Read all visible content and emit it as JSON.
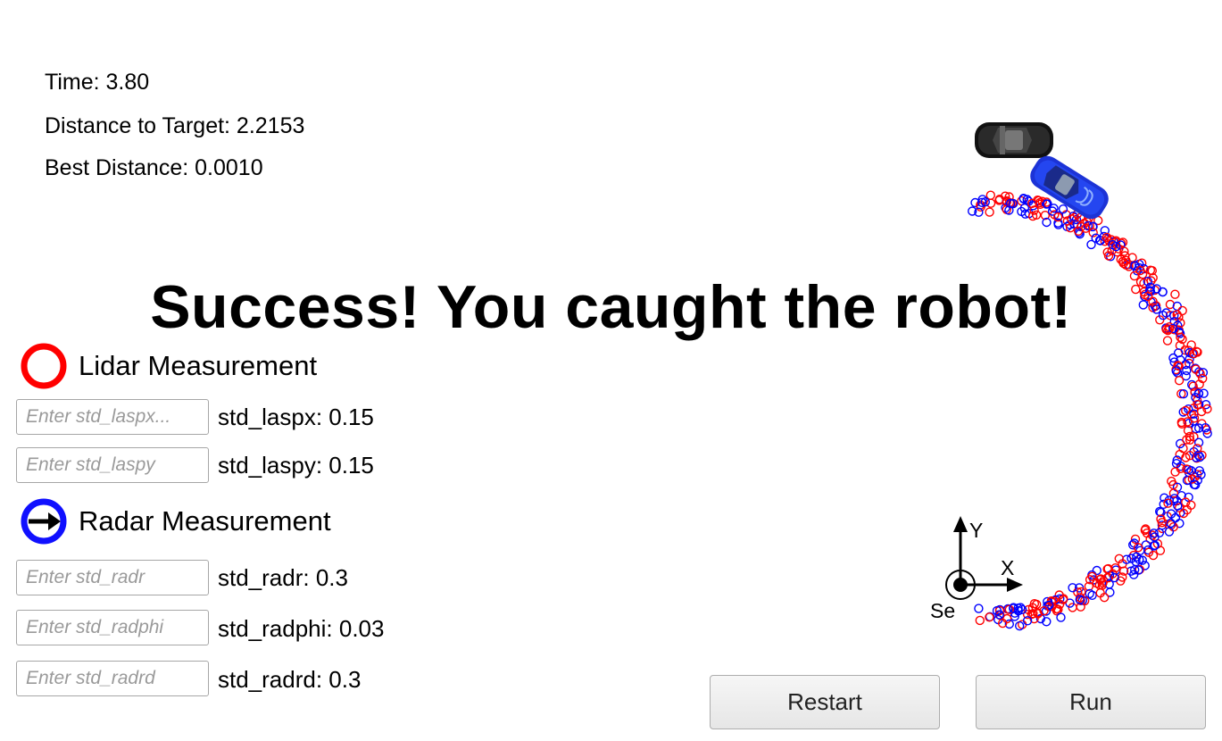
{
  "stats": {
    "time": "Time: 3.80",
    "distance_to_target": "Distance to Target: 2.2153",
    "best_distance": "Best Distance: 0.0010"
  },
  "headline": "Success! You caught the robot!",
  "lidar": {
    "legend_label": "Lidar Measurement",
    "color": "#ff0000",
    "params": [
      {
        "placeholder": "Enter std_laspx...",
        "label": "std_laspx: 0.15"
      },
      {
        "placeholder": "Enter std_laspy",
        "label": "std_laspy: 0.15"
      }
    ]
  },
  "radar": {
    "legend_label": "Radar Measurement",
    "color": "#0000ff",
    "params": [
      {
        "placeholder": "Enter std_radr",
        "label": "std_radr: 0.3"
      },
      {
        "placeholder": "Enter std_radphi",
        "label": "std_radphi: 0.03"
      },
      {
        "placeholder": "Enter std_radrd",
        "label": "std_radrd: 0.3"
      }
    ]
  },
  "axes": {
    "x_label": "X",
    "y_label": "Y",
    "origin_label": "Se"
  },
  "buttons": {
    "restart": "Restart",
    "run": "Run"
  },
  "icons": {
    "lidar_legend": "red-ring-icon",
    "radar_legend": "blue-ring-arrow-icon",
    "target": "black-car-icon",
    "chaser": "blue-car-icon"
  }
}
